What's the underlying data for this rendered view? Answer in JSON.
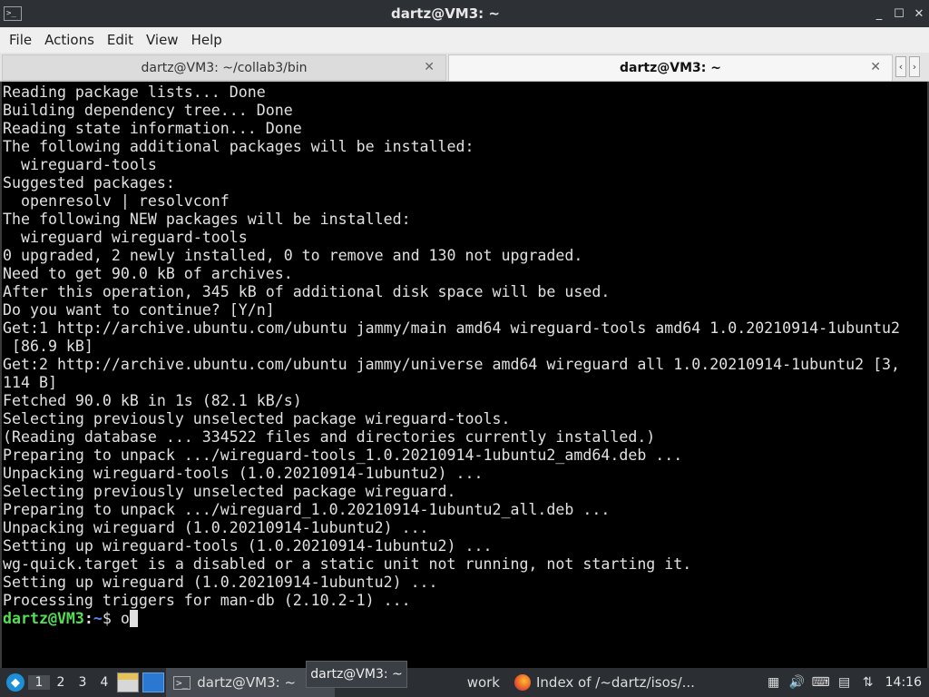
{
  "window": {
    "title": "dartz@VM3: ~",
    "app_icon": "terminal-icon",
    "controls": {
      "minimize": "_",
      "maximize": "☐",
      "close": "✕"
    }
  },
  "menu": {
    "items": [
      "File",
      "Actions",
      "Edit",
      "View",
      "Help"
    ]
  },
  "tabs": [
    {
      "label": "dartz@VM3: ~/collab3/bin",
      "active": false
    },
    {
      "label": "dartz@VM3: ~",
      "active": true
    }
  ],
  "tab_nav": {
    "prev": "‹",
    "next": "›"
  },
  "terminal": {
    "lines": [
      "Reading package lists... Done",
      "Building dependency tree... Done",
      "Reading state information... Done",
      "The following additional packages will be installed:",
      "  wireguard-tools",
      "Suggested packages:",
      "  openresolv | resolvconf",
      "The following NEW packages will be installed:",
      "  wireguard wireguard-tools",
      "0 upgraded, 2 newly installed, 0 to remove and 130 not upgraded.",
      "Need to get 90.0 kB of archives.",
      "After this operation, 345 kB of additional disk space will be used.",
      "Do you want to continue? [Y/n]",
      "Get:1 http://archive.ubuntu.com/ubuntu jammy/main amd64 wireguard-tools amd64 1.0.20210914-1ubuntu2",
      " [86.9 kB]",
      "Get:2 http://archive.ubuntu.com/ubuntu jammy/universe amd64 wireguard all 1.0.20210914-1ubuntu2 [3,",
      "114 B]",
      "Fetched 90.0 kB in 1s (82.1 kB/s)",
      "Selecting previously unselected package wireguard-tools.",
      "(Reading database ... 334522 files and directories currently installed.)",
      "Preparing to unpack .../wireguard-tools_1.0.20210914-1ubuntu2_amd64.deb ...",
      "Unpacking wireguard-tools (1.0.20210914-1ubuntu2) ...",
      "Selecting previously unselected package wireguard.",
      "Preparing to unpack .../wireguard_1.0.20210914-1ubuntu2_all.deb ...",
      "Unpacking wireguard (1.0.20210914-1ubuntu2) ...",
      "Setting up wireguard-tools (1.0.20210914-1ubuntu2) ...",
      "wg-quick.target is a disabled or a static unit not running, not starting it.",
      "Setting up wireguard (1.0.20210914-1ubuntu2) ...",
      "Processing triggers for man-db (2.10.2-1) ..."
    ],
    "prompt": {
      "user": "dartz@VM3",
      "sep": ":",
      "path": "~",
      "symbol": "$ ",
      "input": "o"
    }
  },
  "taskbar": {
    "desktops": [
      "1",
      "2",
      "3",
      "4"
    ],
    "active_desktop": "1",
    "tasks": [
      {
        "label": "dartz@VM3: ~",
        "icon": "terminal-icon",
        "active": true
      },
      {
        "label": "work",
        "icon": "window-icon",
        "active": false
      },
      {
        "label": "Index of /~dartz/isos/...",
        "icon": "firefox-icon",
        "active": false
      }
    ],
    "tray_icons": [
      "clipboard-icon",
      "volume-icon",
      "keyboard-icon",
      "notes-icon",
      "network-icon"
    ],
    "clock": "14:16"
  },
  "tooltip": {
    "text": "dartz@VM3: ~"
  },
  "colors": {
    "prompt_user": "#55dd55",
    "prompt_path": "#5588ff",
    "terminal_bg": "#000000",
    "terminal_fg": "#e0e0e0"
  }
}
